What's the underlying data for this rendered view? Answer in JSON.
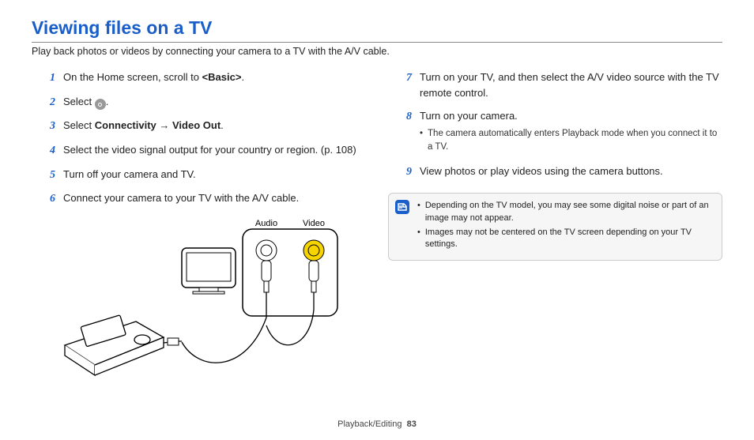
{
  "title": "Viewing files on a TV",
  "intro": "Play back photos or videos by connecting your camera to a TV with the A/V cable.",
  "left_steps": [
    {
      "n": "1",
      "html": "On the Home screen, scroll to <b>&lt;Basic&gt;</b>."
    },
    {
      "n": "2",
      "html": "Select {icon}."
    },
    {
      "n": "3",
      "html": "Select <b>Connectivity</b> → <b>Video Out</b>."
    },
    {
      "n": "4",
      "html": "Select the video signal output for your country or region. (p. 108)"
    },
    {
      "n": "5",
      "html": "Turn off your camera and TV."
    },
    {
      "n": "6",
      "html": "Connect your camera to your TV with the A/V cable."
    }
  ],
  "diagram_labels": {
    "audio": "Audio",
    "video": "Video"
  },
  "right_steps": [
    {
      "n": "7",
      "html": "Turn on your TV, and then select the A/V video source with the TV remote control."
    },
    {
      "n": "8",
      "html": "Turn on your camera.",
      "sub": [
        "The camera automatically enters Playback mode when you connect it to a TV."
      ]
    },
    {
      "n": "9",
      "html": "View photos or play videos using the camera buttons."
    }
  ],
  "notes": [
    "Depending on the TV model, you may see some digital noise or part of an image may not appear.",
    "Images may not be centered on the TV screen depending on your TV settings."
  ],
  "footer": {
    "section": "Playback/Editing",
    "page": "83"
  }
}
